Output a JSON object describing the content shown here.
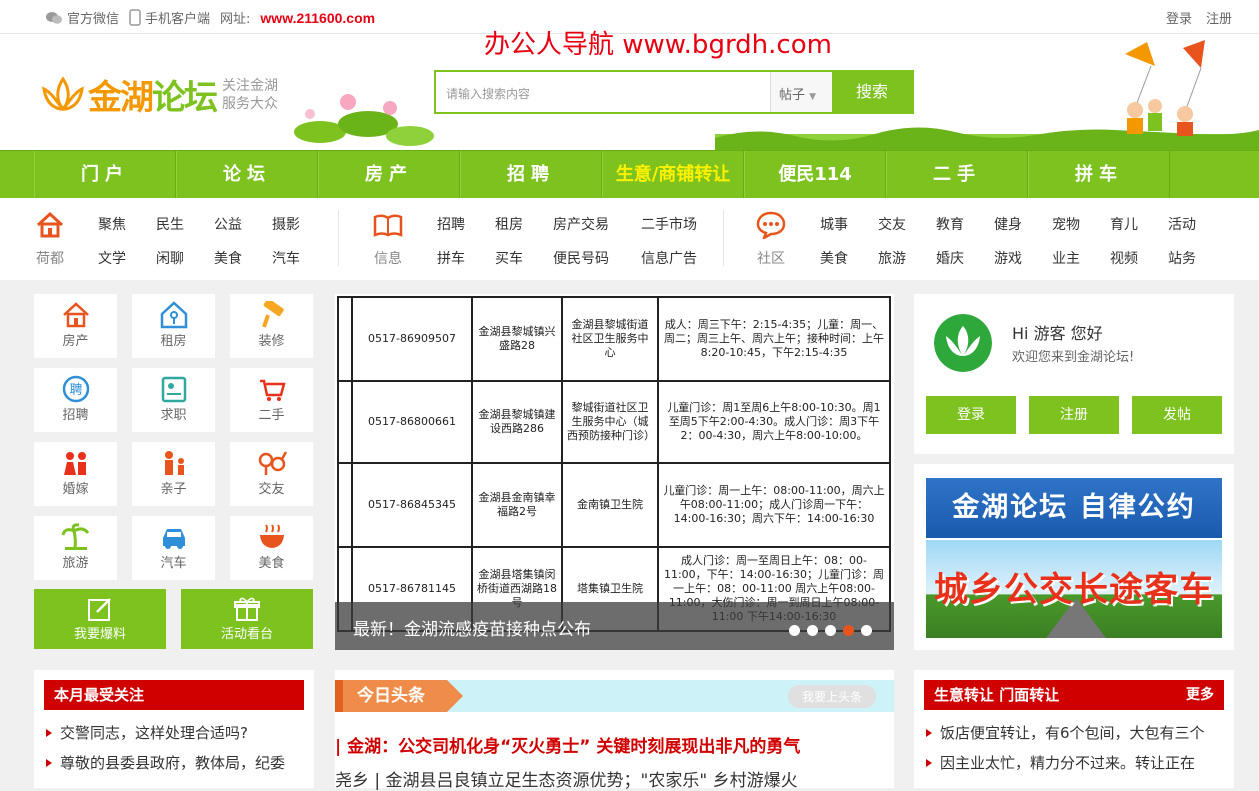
{
  "topbar": {
    "wechat": "官方微信",
    "mobile": "手机客户端",
    "url_label": "网址:",
    "url": "www.211600.com",
    "login": "登录",
    "register": "注册"
  },
  "watermark": "办公人导航 www.bgrdh.com",
  "logo": {
    "name_a": "金湖",
    "name_b": "论坛",
    "slogan1": "关注金湖",
    "slogan2": "服务大众"
  },
  "search": {
    "placeholder": "请输入搜索内容",
    "type": "帖子",
    "button": "搜索"
  },
  "nav": [
    "门户",
    "论坛",
    "房产",
    "招聘",
    "生意/商铺转让",
    "便民114",
    "二手",
    "拼车"
  ],
  "subnav": {
    "g1": {
      "icon_label": "荷都",
      "row1": [
        "聚焦",
        "民生",
        "公益",
        "摄影"
      ],
      "row2": [
        "文学",
        "闲聊",
        "美食",
        "汽车"
      ]
    },
    "g2": {
      "icon_label": "信息",
      "row1": [
        "招聘",
        "租房",
        "房产交易",
        "二手市场"
      ],
      "row2": [
        "拼车",
        "买车",
        "便民号码",
        "信息广告"
      ]
    },
    "g3": {
      "icon_label": "社区",
      "row1": [
        "城事",
        "交友",
        "教育",
        "健身",
        "宠物",
        "育儿",
        "活动"
      ],
      "row2": [
        "美食",
        "旅游",
        "婚庆",
        "游戏",
        "业主",
        "视频",
        "站务"
      ]
    }
  },
  "grid": [
    "房产",
    "租房",
    "装修",
    "招聘",
    "求职",
    "二手",
    "婚嫁",
    "亲子",
    "交友",
    "旅游",
    "汽车",
    "美食"
  ],
  "big_buttons": [
    "我要爆料",
    "活动看台"
  ],
  "slider": {
    "caption": "最新！金湖流感疫苗接种点公布",
    "rows": [
      [
        "0517-86909507",
        "金湖县黎城镇兴盛路28",
        "金湖县黎城街道社区卫生服务中心",
        "成人：周三下午：2:15-4:35；儿童：周一、周二；周三上午、周六上午；接种时间：上午8:20-10:45，下午2:15-4:35"
      ],
      [
        "0517-86800661",
        "金湖县黎城镇建设西路286",
        "黎城街道社区卫生服务中心（城西预防接种门诊）",
        "儿童门诊：周1至周6上午8:00-10:30。周1至周5下午2:00-4:30。成人门诊：周3下午2：00-4:30，周六上午8:00-10:00。"
      ],
      [
        "0517-86845345",
        "金湖县金南镇幸福路2号",
        "金南镇卫生院",
        "儿童门诊：周一上午：08:00-11:00，周六上午08:00-11:00；成人门诊周一下午：14:00-16:30；周六下午：14:00-16:30"
      ],
      [
        "0517-86781145",
        "金湖县塔集镇闵桥街道西湖路18号",
        "塔集镇卫生院",
        "成人门诊：周一至周日上午：08：00-11:00，下午：14:00-16:30；儿童门诊：周一上午：08：00-11:00 周六上午08:00-11:00，大伤门诊：周一到周日上午08:00-11:00 下午14:00-16:30"
      ]
    ]
  },
  "user": {
    "hi": "Hi 游客 您好",
    "welcome": "欢迎您来到金湖论坛!",
    "login": "登录",
    "register": "注册",
    "post": "发帖"
  },
  "banners": {
    "b1": "金湖论坛 自律公约",
    "b2": "城乡公交长途客车"
  },
  "monthly": {
    "title": "本月最受关注",
    "items": [
      "交警同志，这样处理合适吗?",
      "尊敬的县委县政府，教体局，纪委"
    ]
  },
  "news": {
    "tag": "今日头条",
    "more": "我要上头条",
    "headline": "| 金湖：公交司机化身“灭火勇士” 关键时刻展现出非凡的勇气",
    "line2": "尧乡 | 金湖县吕良镇立足生态资源优势；\"农家乐\" 乡村游爆火"
  },
  "transfer": {
    "title": "生意转让 门面转让",
    "more": "更多",
    "items": [
      "饭店便宜转让，有6个包间，大包有三个",
      "因主业太忙，精力分不过来。转让正在"
    ]
  },
  "colors": {
    "green": "#7dc21e",
    "red": "#d10000",
    "orange": "#f08c4a"
  }
}
